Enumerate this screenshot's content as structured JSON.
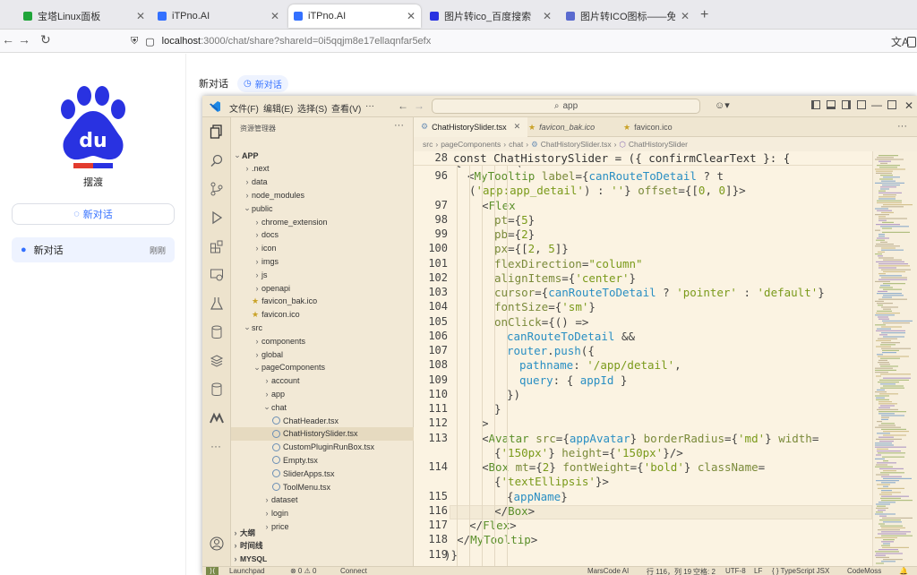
{
  "browser": {
    "tabs": [
      {
        "title": "宝塔Linux面板",
        "favicon_color": "#20a53a"
      },
      {
        "title": "iTPno.AI",
        "favicon_color": "#3370ff"
      },
      {
        "title": "iTPno.AI",
        "favicon_color": "#3370ff"
      },
      {
        "title": "图片转ico_百度搜索",
        "favicon_color": "#2932e1"
      },
      {
        "title": "图片转ICO图标——免费在",
        "favicon_color": "#5a6acf"
      }
    ],
    "active_tab": 2,
    "url_host": "localhost",
    "url_rest": ":3000/chat/share?shareId=0i5qqjm8e17ellaqnfar5efx"
  },
  "app": {
    "name": "摆渡",
    "new_chat_button": "新对话",
    "history": [
      {
        "title": "新对话",
        "time": "刚刚"
      }
    ],
    "header_title": "新对话",
    "header_pill": "新对话"
  },
  "vscode": {
    "menus": [
      "文件(F)",
      "编辑(E)",
      "选择(S)",
      "查看(V)",
      "···"
    ],
    "search": "app",
    "explorer_title": "资源管理器",
    "tree": [
      {
        "label": "APP",
        "depth": 0,
        "kind": "open",
        "bold": true
      },
      {
        "label": ".next",
        "depth": 1,
        "kind": "closed"
      },
      {
        "label": "data",
        "depth": 1,
        "kind": "closed"
      },
      {
        "label": "node_modules",
        "depth": 1,
        "kind": "closed"
      },
      {
        "label": "public",
        "depth": 1,
        "kind": "open"
      },
      {
        "label": "chrome_extension",
        "depth": 2,
        "kind": "closed"
      },
      {
        "label": "docs",
        "depth": 2,
        "kind": "closed"
      },
      {
        "label": "icon",
        "depth": 2,
        "kind": "closed"
      },
      {
        "label": "imgs",
        "depth": 2,
        "kind": "closed"
      },
      {
        "label": "js",
        "depth": 2,
        "kind": "closed"
      },
      {
        "label": "openapi",
        "depth": 2,
        "kind": "closed"
      },
      {
        "label": "favicon_bak.ico",
        "depth": 1,
        "kind": "star"
      },
      {
        "label": "favicon.ico",
        "depth": 1,
        "kind": "star"
      },
      {
        "label": "src",
        "depth": 1,
        "kind": "open"
      },
      {
        "label": "components",
        "depth": 2,
        "kind": "closed"
      },
      {
        "label": "global",
        "depth": 2,
        "kind": "closed"
      },
      {
        "label": "pageComponents",
        "depth": 2,
        "kind": "open"
      },
      {
        "label": "account",
        "depth": 3,
        "kind": "closed"
      },
      {
        "label": "app",
        "depth": 3,
        "kind": "closed"
      },
      {
        "label": "chat",
        "depth": 3,
        "kind": "open"
      },
      {
        "label": "ChatHeader.tsx",
        "depth": 4,
        "kind": "file"
      },
      {
        "label": "ChatHistorySlider.tsx",
        "depth": 4,
        "kind": "file",
        "selected": true
      },
      {
        "label": "CustomPluginRunBox.tsx",
        "depth": 4,
        "kind": "file"
      },
      {
        "label": "Empty.tsx",
        "depth": 4,
        "kind": "file"
      },
      {
        "label": "SliderApps.tsx",
        "depth": 4,
        "kind": "file"
      },
      {
        "label": "ToolMenu.tsx",
        "depth": 4,
        "kind": "file"
      },
      {
        "label": "dataset",
        "depth": 3,
        "kind": "closed"
      },
      {
        "label": "login",
        "depth": 3,
        "kind": "closed"
      },
      {
        "label": "price",
        "depth": 3,
        "kind": "closed"
      }
    ],
    "sections": [
      "大纲",
      "时间线",
      "MYSQL"
    ],
    "editor_tabs": [
      {
        "label": "ChatHistorySlider.tsx",
        "active": true
      },
      {
        "label": "favicon_bak.ico",
        "italic": true
      },
      {
        "label": "favicon.ico"
      }
    ],
    "breadcrumb": [
      "src",
      "pageComponents",
      "chat",
      "ChatHistorySlider.tsx",
      "ChatHistorySlider"
    ],
    "sticky_line_no": "28",
    "sticky_code": "const ChatHistorySlider = ({ confirmClearText }: {",
    "code": [
      {
        "n": "95",
        "t": "{isPc && ("
      },
      {
        "n": "96",
        "t": "<MyTooltip label={canRouteToDetail ? t"
      },
      {
        "n": "",
        "t": "('app:app_detail') : ''} offset={[0, 0]}>"
      },
      {
        "n": "97",
        "t": "<Flex"
      },
      {
        "n": "98",
        "t": "pt={5}"
      },
      {
        "n": "99",
        "t": "pb={2}"
      },
      {
        "n": "100",
        "t": "px={[2, 5]}"
      },
      {
        "n": "101",
        "t": "flexDirection=\"column\""
      },
      {
        "n": "102",
        "t": "alignItems={'center'}"
      },
      {
        "n": "103",
        "t": "cursor={canRouteToDetail ? 'pointer' : 'default'}"
      },
      {
        "n": "104",
        "t": "fontSize={'sm'}"
      },
      {
        "n": "105",
        "t": "onClick={() =>"
      },
      {
        "n": "106",
        "t": "canRouteToDetail &&"
      },
      {
        "n": "107",
        "t": "router.push({"
      },
      {
        "n": "108",
        "t": "pathname: '/app/detail',"
      },
      {
        "n": "109",
        "t": "query: { appId }"
      },
      {
        "n": "110",
        "t": "})"
      },
      {
        "n": "111",
        "t": "}"
      },
      {
        "n": "112",
        "t": ">"
      },
      {
        "n": "113",
        "t": "<Avatar src={appAvatar} borderRadius={'md'} width="
      },
      {
        "n": "",
        "t": "{'150px'} height={'150px'}/>"
      },
      {
        "n": "114",
        "t": "<Box mt={2} fontWeight={'bold'} className="
      },
      {
        "n": "",
        "t": "{'textEllipsis'}>"
      },
      {
        "n": "115",
        "t": "{appName}"
      },
      {
        "n": "116",
        "t": "</Box>"
      },
      {
        "n": "117",
        "t": "</Flex>"
      },
      {
        "n": "118",
        "t": "</MyTooltip>"
      },
      {
        "n": "119",
        "t": ")}"
      }
    ],
    "status": {
      "launchpad": "Launchpad",
      "problems": "⊗ 0 ⚠ 0",
      "connect": "Connect",
      "marscode": "MarsCode AI",
      "position": "行 116，列 19",
      "spaces": "空格: 2",
      "encoding": "UTF-8",
      "eol": "LF",
      "language": "{ } TypeScript JSX",
      "codemoss": "CodeMoss"
    },
    "colors": {
      "accent": "#3370ff",
      "editor_bg": "#fbf3e2",
      "sidebar_bg": "#f2e9d6"
    }
  }
}
